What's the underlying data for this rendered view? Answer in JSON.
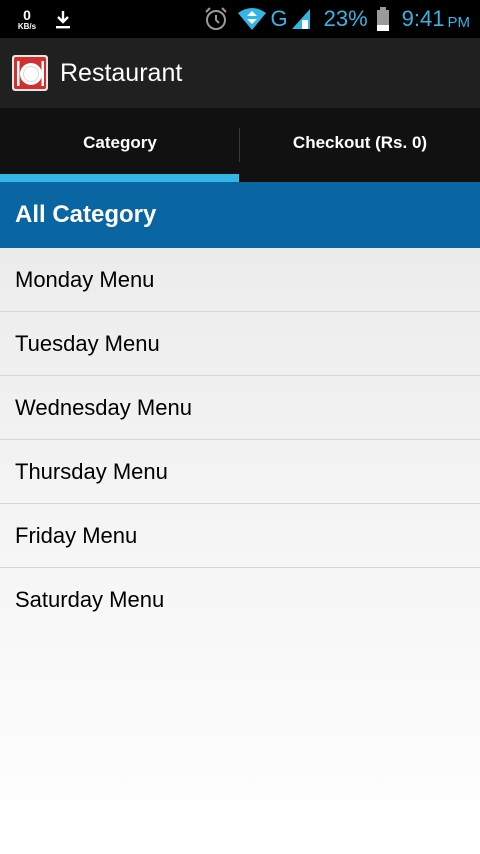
{
  "status_bar": {
    "net_speed": "0",
    "net_unit": "KB/s",
    "network_type": "G",
    "battery": "23%",
    "time": "9:41",
    "ampm": "PM",
    "icons": [
      "download-icon",
      "alarm-icon",
      "wifi-icon",
      "signal-icon",
      "battery-icon"
    ]
  },
  "action_bar": {
    "title": "Restaurant",
    "icon": "restaurant-plate-icon"
  },
  "tabs": [
    {
      "label": "Category",
      "selected": true
    },
    {
      "label": "Checkout (Rs. 0)",
      "selected": false
    }
  ],
  "list": {
    "header": "All Category",
    "items": [
      "Monday Menu",
      "Tuesday Menu",
      "Wednesday Menu",
      "Thursday Menu",
      "Friday Menu",
      "Saturday Menu"
    ]
  },
  "colors": {
    "accent": "#33b5e5",
    "header_bg": "#0a65a3",
    "action_bar_bg": "#202020",
    "tab_bg": "#111111"
  }
}
